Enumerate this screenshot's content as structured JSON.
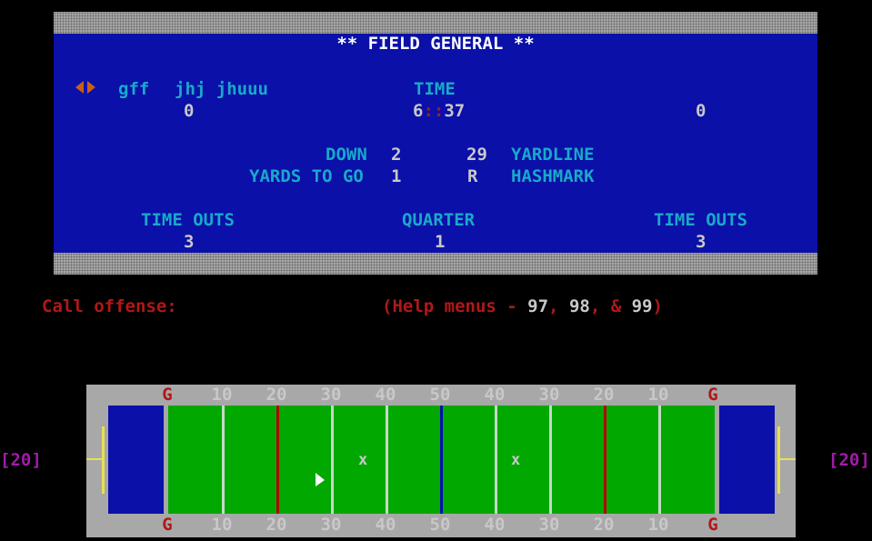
{
  "title": "** FIELD GENERAL **",
  "possession_icon": "possession-arrows-icon",
  "home": {
    "name": "gff",
    "score": "0",
    "timeouts": "3"
  },
  "away": {
    "name": "jhj jhuuu",
    "score": "0",
    "timeouts": "3"
  },
  "clock": {
    "label": "TIME",
    "minutes": "6",
    "separator": "::",
    "seconds": "37"
  },
  "situation": {
    "down_label": "DOWN",
    "down": "2",
    "yardline": "29",
    "yardline_label": "YARDLINE",
    "ytg_label": "YARDS TO GO",
    "ytg": "1",
    "hashmark": "R",
    "hashmark_label": "HASHMARK"
  },
  "timeouts_label": "TIME OUTS",
  "quarter_label": "QUARTER",
  "quarter": "1",
  "prompt": "Call offense:",
  "help": {
    "open": "(Help menus - ",
    "m1": "97",
    "sep1": ", ",
    "m2": "98",
    "sep2": ", & ",
    "m3": "99",
    "close": ")"
  },
  "field": {
    "yard_labels": [
      "G",
      "10",
      "20",
      "30",
      "40",
      "50",
      "40",
      "30",
      "20",
      "10",
      "G"
    ],
    "marker": "x",
    "left_box": "[20]",
    "right_box": "[20]"
  },
  "colors": {
    "scoreboard_blue": "#0a10a8",
    "field_green": "#00a800",
    "label_cyan": "#19a9c9",
    "value_white": "#c8c8c8",
    "prompt_red": "#b01818",
    "scrimmage_line": "#0010b0",
    "first_down_line": "#b00000",
    "goalpost_yellow": "#e8e050"
  }
}
